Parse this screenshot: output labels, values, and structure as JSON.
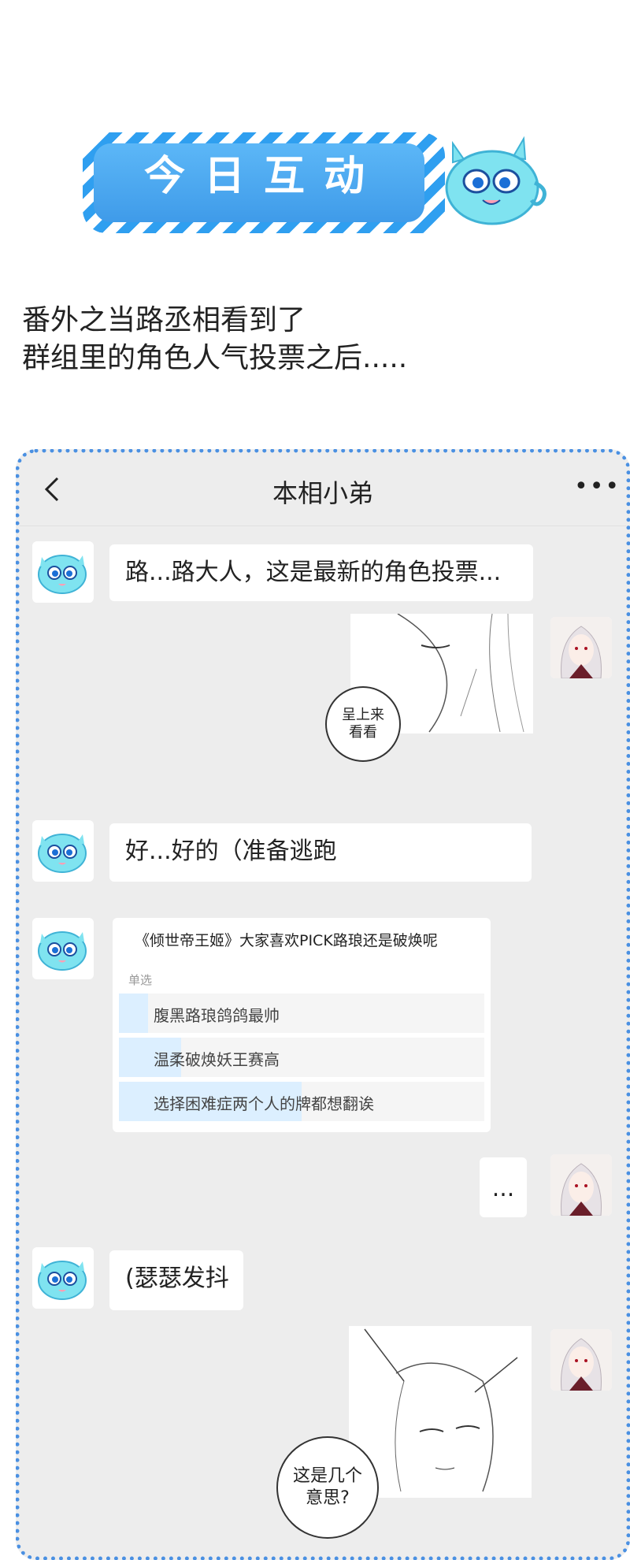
{
  "banner": {
    "title": "今日互动"
  },
  "headline": {
    "line1": "番外之当路丞相看到了",
    "line2": "群组里的角色人气投票之后....."
  },
  "chat": {
    "title": "本相小弟",
    "more": "•••",
    "messages": {
      "m1": "路...路大人，这是最新的角色投票...",
      "m2_speech_l1": "呈上来",
      "m2_speech_l2": "看看",
      "m3": "好...好的（准备逃跑",
      "m5": "...",
      "m6": "(瑟瑟发抖",
      "m7_speech_l1": "这是几个",
      "m7_speech_l2": "意思?"
    },
    "poll": {
      "title": "《倾世帝王姬》大家喜欢PICK路琅还是破焕呢",
      "type": "单选",
      "options": [
        {
          "label": "腹黑路琅鸽鸽最帅",
          "fraction": 0.08
        },
        {
          "label": "温柔破焕妖王赛高",
          "fraction": 0.17
        },
        {
          "label": "选择困难症两个人的牌都想翻诶",
          "fraction": 0.5
        }
      ]
    }
  },
  "colors": {
    "accent": "#4a90e2",
    "mascot": "#7fe3f0",
    "chat_bg": "#ededed",
    "poll_fill": "#dcefff"
  },
  "icons": {
    "back": "chevron-left-icon",
    "more": "more-dots-icon",
    "mascot": "blue-monster-mascot"
  }
}
